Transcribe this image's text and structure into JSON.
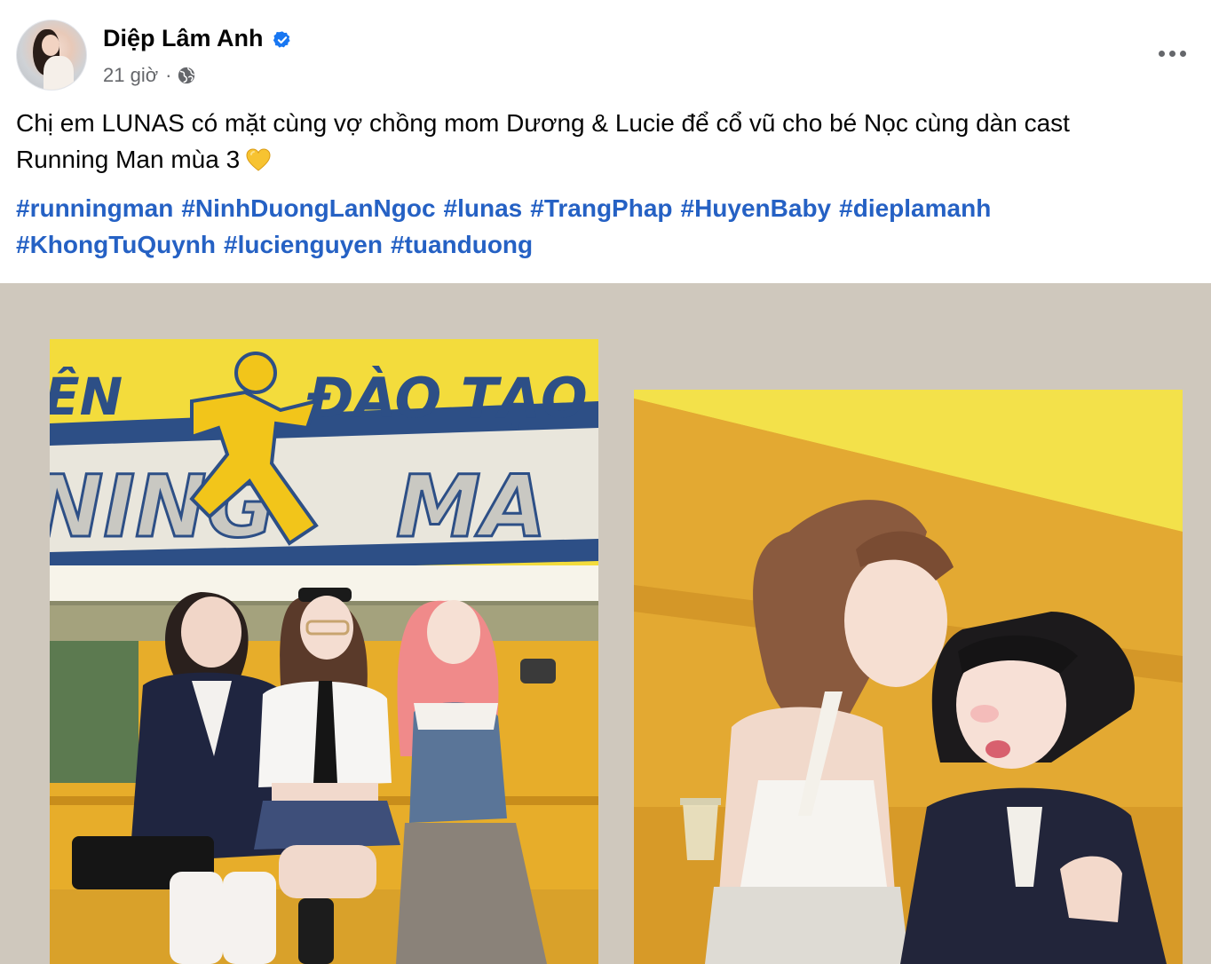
{
  "author": {
    "name": "Diệp Lâm Anh",
    "time": "21 giờ",
    "separator": "·"
  },
  "post": {
    "text_line1": "Chị em LUNAS có mặt cùng vợ chồng mom Dương & Lucie để cổ vũ cho bé Nọc cùng dàn cast",
    "text_line2": "Running Man mùa 3",
    "hashtags_row1": [
      "#runningman",
      "#NinhDuongLanNgoc",
      "#lunas",
      "#TrangPhap",
      "#HuyenBaby",
      "#dieplamanh"
    ],
    "hashtags_row2": [
      "#KhongTuQuynh",
      "#lucienguyen",
      "#tuanduong"
    ]
  },
  "photos": {
    "photo1_sign_line1": "ÊN",
    "photo1_sign_line2": "ĐÀO TẠO",
    "photo1_sign_line3": "NING",
    "photo1_sign_line4": "MA"
  },
  "colors": {
    "hashtag": "#2561c4",
    "verified": "#1877f2",
    "meta": "#65676b",
    "media_background": "#cfc8bd"
  },
  "icons": [
    "verified-badge-icon",
    "globe-icon",
    "more-options-icon",
    "yellow-heart-icon"
  ]
}
